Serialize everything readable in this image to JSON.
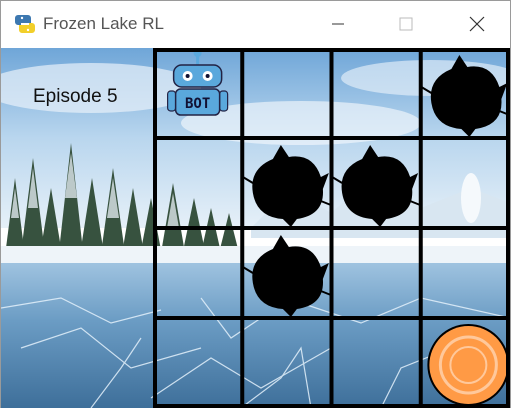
{
  "window": {
    "title": "Frozen Lake RL",
    "icon": "python-snake-icon",
    "controls": [
      "minimize-icon",
      "maximize-icon",
      "close-icon"
    ]
  },
  "game": {
    "episode_label": "Episode 5",
    "grid": {
      "rows": 4,
      "cols": 4,
      "cells": [
        [
          "agent",
          "frozen",
          "frozen",
          "hole"
        ],
        [
          "frozen",
          "hole",
          "hole",
          "frozen"
        ],
        [
          "frozen",
          "hole",
          "frozen",
          "frozen"
        ],
        [
          "frozen",
          "frozen",
          "frozen",
          "goal"
        ]
      ]
    },
    "agent": {
      "label": "BOT",
      "row": 0,
      "col": 0
    }
  },
  "colors": {
    "grid_line": "#000000",
    "sky": "#9ec7e8",
    "ice": "#5f93b9",
    "goal": "#ff9a45",
    "bot_body": "#5aa8dc"
  }
}
